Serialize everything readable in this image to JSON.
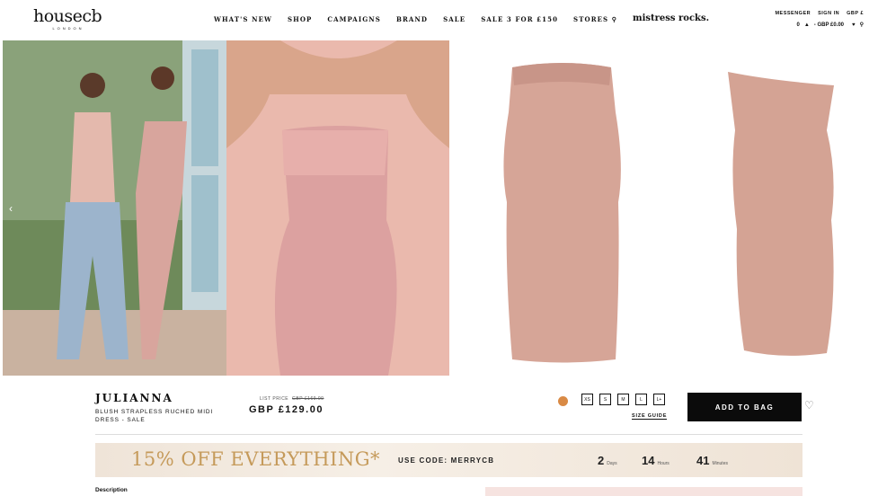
{
  "header": {
    "logo": "housecb",
    "logo_sub": "LONDON",
    "nav": [
      "WHAT'S NEW",
      "SHOP",
      "CAMPAIGNS",
      "BRAND",
      "SALE",
      "SALE 3 FOR £150",
      "STORES"
    ],
    "nav_script": "mistress rocks.",
    "util_row1": [
      "MESSENGER",
      "SIGN IN",
      "GBP £"
    ],
    "basket": "0",
    "basket_total": "- GBP £0.00"
  },
  "product": {
    "name": "JULIANNA",
    "description": "BLUSH STRAPLESS RUCHED MIDI DRESS - SALE",
    "list_price_label": "LIST PRICE",
    "list_price": "GBP £169.00",
    "price": "GBP £129.00",
    "sizes": [
      "XS",
      "S",
      "M",
      "L",
      "L+"
    ],
    "size_guide": "SIZE GUIDE",
    "add_to_bag": "ADD TO BAG",
    "swatch_color": "#d98a45"
  },
  "promo": {
    "headline": "15% OFF EVERYTHING*",
    "code_text": "USE CODE: MERRYCB",
    "days": "2",
    "days_label": "Days",
    "hours": "14",
    "hours_label": "Hours",
    "minutes": "41",
    "minutes_label": "Minutes"
  },
  "section": {
    "description_label": "Description"
  }
}
